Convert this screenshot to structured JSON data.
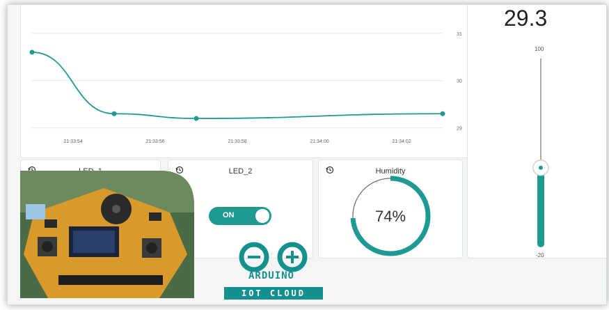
{
  "chart_data": {
    "type": "line",
    "x": [
      "21:33:54",
      "21:33:56",
      "21:33:58",
      "21:34:00",
      "21:34:02"
    ],
    "points": [
      {
        "t": "21:33:53",
        "v": 30.6
      },
      {
        "t": "21:33:55",
        "v": 29.3
      },
      {
        "t": "21:33:57",
        "v": 29.2
      },
      {
        "t": "21:34:03",
        "v": 29.3
      }
    ],
    "y_ticks": [
      "31",
      "30",
      "29"
    ],
    "ylim": [
      28.95,
      31.35
    ],
    "color": "#1e9a93",
    "grid": true
  },
  "cards": {
    "led1": {
      "title": "LED_1"
    },
    "led2": {
      "title": "LED_2",
      "switch_label": "ON",
      "switch_on": true
    },
    "humidity": {
      "title": "Humidity",
      "value_text": "74%",
      "value": 74
    }
  },
  "temperature": {
    "value_text": "29.3",
    "value": 29.3,
    "max_label": "100",
    "min_label": "-20"
  },
  "logo": {
    "name": "ARDUINO",
    "tagline": "IOT CLOUD",
    "color": "#14908e"
  },
  "icons": {
    "history": "history-icon",
    "minus": "minus-icon",
    "plus": "plus-icon"
  }
}
